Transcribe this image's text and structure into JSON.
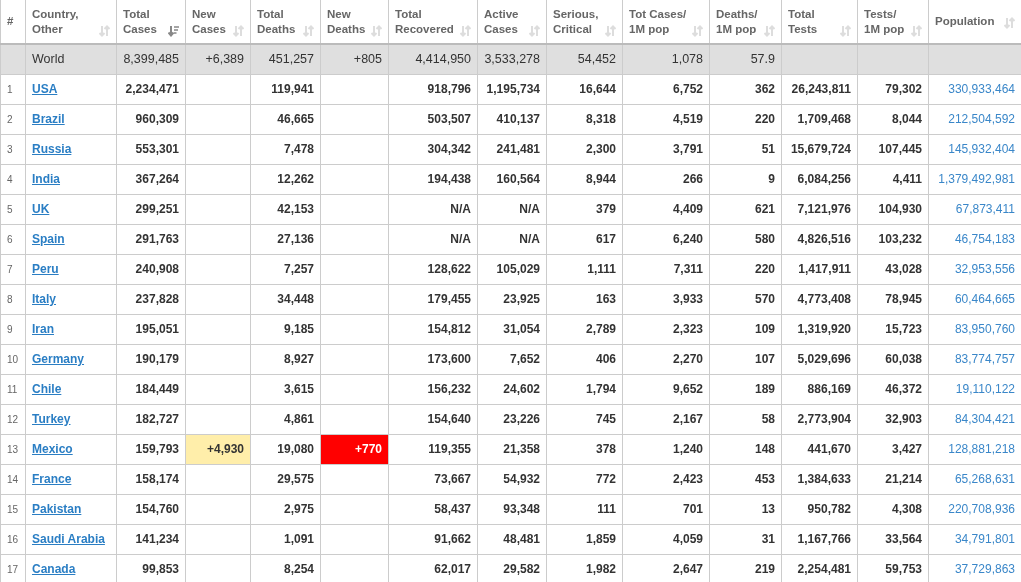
{
  "columns": [
    {
      "label": "#"
    },
    {
      "label": "Country,\nOther",
      "sorted": false
    },
    {
      "label": "Total\nCases",
      "sorted": true
    },
    {
      "label": "New\nCases",
      "sorted": false
    },
    {
      "label": "Total\nDeaths",
      "sorted": false
    },
    {
      "label": "New\nDeaths",
      "sorted": false
    },
    {
      "label": "Total\nRecovered",
      "sorted": false
    },
    {
      "label": "Active\nCases",
      "sorted": false
    },
    {
      "label": "Serious,\nCritical",
      "sorted": false
    },
    {
      "label": "Tot Cases/\n1M pop",
      "sorted": false
    },
    {
      "label": "Deaths/\n1M pop",
      "sorted": false
    },
    {
      "label": "Total\nTests",
      "sorted": false
    },
    {
      "label": "Tests/\n1M pop",
      "sorted": false
    },
    {
      "label": "Population",
      "sorted": false
    }
  ],
  "world": [
    "World",
    "8,399,485",
    "+6,389",
    "451,257",
    "+805",
    "4,414,950",
    "3,533,278",
    "54,452",
    "1,078",
    "57.9"
  ],
  "rows": [
    {
      "rank": "1",
      "country": "USA",
      "cells": [
        "2,234,471",
        "",
        "119,941",
        "",
        "918,796",
        "1,195,734",
        "16,644",
        "6,752",
        "362",
        "26,243,811",
        "79,302"
      ],
      "population": "330,933,464"
    },
    {
      "rank": "2",
      "country": "Brazil",
      "cells": [
        "960,309",
        "",
        "46,665",
        "",
        "503,507",
        "410,137",
        "8,318",
        "4,519",
        "220",
        "1,709,468",
        "8,044"
      ],
      "population": "212,504,592"
    },
    {
      "rank": "3",
      "country": "Russia",
      "cells": [
        "553,301",
        "",
        "7,478",
        "",
        "304,342",
        "241,481",
        "2,300",
        "3,791",
        "51",
        "15,679,724",
        "107,445"
      ],
      "population": "145,932,404"
    },
    {
      "rank": "4",
      "country": "India",
      "cells": [
        "367,264",
        "",
        "12,262",
        "",
        "194,438",
        "160,564",
        "8,944",
        "266",
        "9",
        "6,084,256",
        "4,411"
      ],
      "population": "1,379,492,981"
    },
    {
      "rank": "5",
      "country": "UK",
      "cells": [
        "299,251",
        "",
        "42,153",
        "",
        "N/A",
        "N/A",
        "379",
        "4,409",
        "621",
        "7,121,976",
        "104,930"
      ],
      "population": "67,873,411"
    },
    {
      "rank": "6",
      "country": "Spain",
      "cells": [
        "291,763",
        "",
        "27,136",
        "",
        "N/A",
        "N/A",
        "617",
        "6,240",
        "580",
        "4,826,516",
        "103,232"
      ],
      "population": "46,754,183"
    },
    {
      "rank": "7",
      "country": "Peru",
      "cells": [
        "240,908",
        "",
        "7,257",
        "",
        "128,622",
        "105,029",
        "1,111",
        "7,311",
        "220",
        "1,417,911",
        "43,028"
      ],
      "population": "32,953,556"
    },
    {
      "rank": "8",
      "country": "Italy",
      "cells": [
        "237,828",
        "",
        "34,448",
        "",
        "179,455",
        "23,925",
        "163",
        "3,933",
        "570",
        "4,773,408",
        "78,945"
      ],
      "population": "60,464,665"
    },
    {
      "rank": "9",
      "country": "Iran",
      "cells": [
        "195,051",
        "",
        "9,185",
        "",
        "154,812",
        "31,054",
        "2,789",
        "2,323",
        "109",
        "1,319,920",
        "15,723"
      ],
      "population": "83,950,760"
    },
    {
      "rank": "10",
      "country": "Germany",
      "cells": [
        "190,179",
        "",
        "8,927",
        "",
        "173,600",
        "7,652",
        "406",
        "2,270",
        "107",
        "5,029,696",
        "60,038"
      ],
      "population": "83,774,757"
    },
    {
      "rank": "11",
      "country": "Chile",
      "cells": [
        "184,449",
        "",
        "3,615",
        "",
        "156,232",
        "24,602",
        "1,794",
        "9,652",
        "189",
        "886,169",
        "46,372"
      ],
      "population": "19,110,122"
    },
    {
      "rank": "12",
      "country": "Turkey",
      "cells": [
        "182,727",
        "",
        "4,861",
        "",
        "154,640",
        "23,226",
        "745",
        "2,167",
        "58",
        "2,773,904",
        "32,903"
      ],
      "population": "84,304,421"
    },
    {
      "rank": "13",
      "country": "Mexico",
      "cells": [
        "159,793",
        "+4,930",
        "19,080",
        "+770",
        "119,355",
        "21,358",
        "378",
        "1,240",
        "148",
        "441,670",
        "3,427"
      ],
      "population": "128,881,218"
    },
    {
      "rank": "14",
      "country": "France",
      "cells": [
        "158,174",
        "",
        "29,575",
        "",
        "73,667",
        "54,932",
        "772",
        "2,423",
        "453",
        "1,384,633",
        "21,214"
      ],
      "population": "65,268,631"
    },
    {
      "rank": "15",
      "country": "Pakistan",
      "cells": [
        "154,760",
        "",
        "2,975",
        "",
        "58,437",
        "93,348",
        "111",
        "701",
        "13",
        "950,782",
        "4,308"
      ],
      "population": "220,708,936"
    },
    {
      "rank": "16",
      "country": "Saudi Arabia",
      "cells": [
        "141,234",
        "",
        "1,091",
        "",
        "91,662",
        "48,481",
        "1,859",
        "4,059",
        "31",
        "1,167,766",
        "33,564"
      ],
      "population": "34,791,801"
    },
    {
      "rank": "17",
      "country": "Canada",
      "cells": [
        "99,853",
        "",
        "8,254",
        "",
        "62,017",
        "29,582",
        "1,982",
        "2,647",
        "219",
        "2,254,481",
        "59,753"
      ],
      "population": "37,729,863"
    }
  ]
}
